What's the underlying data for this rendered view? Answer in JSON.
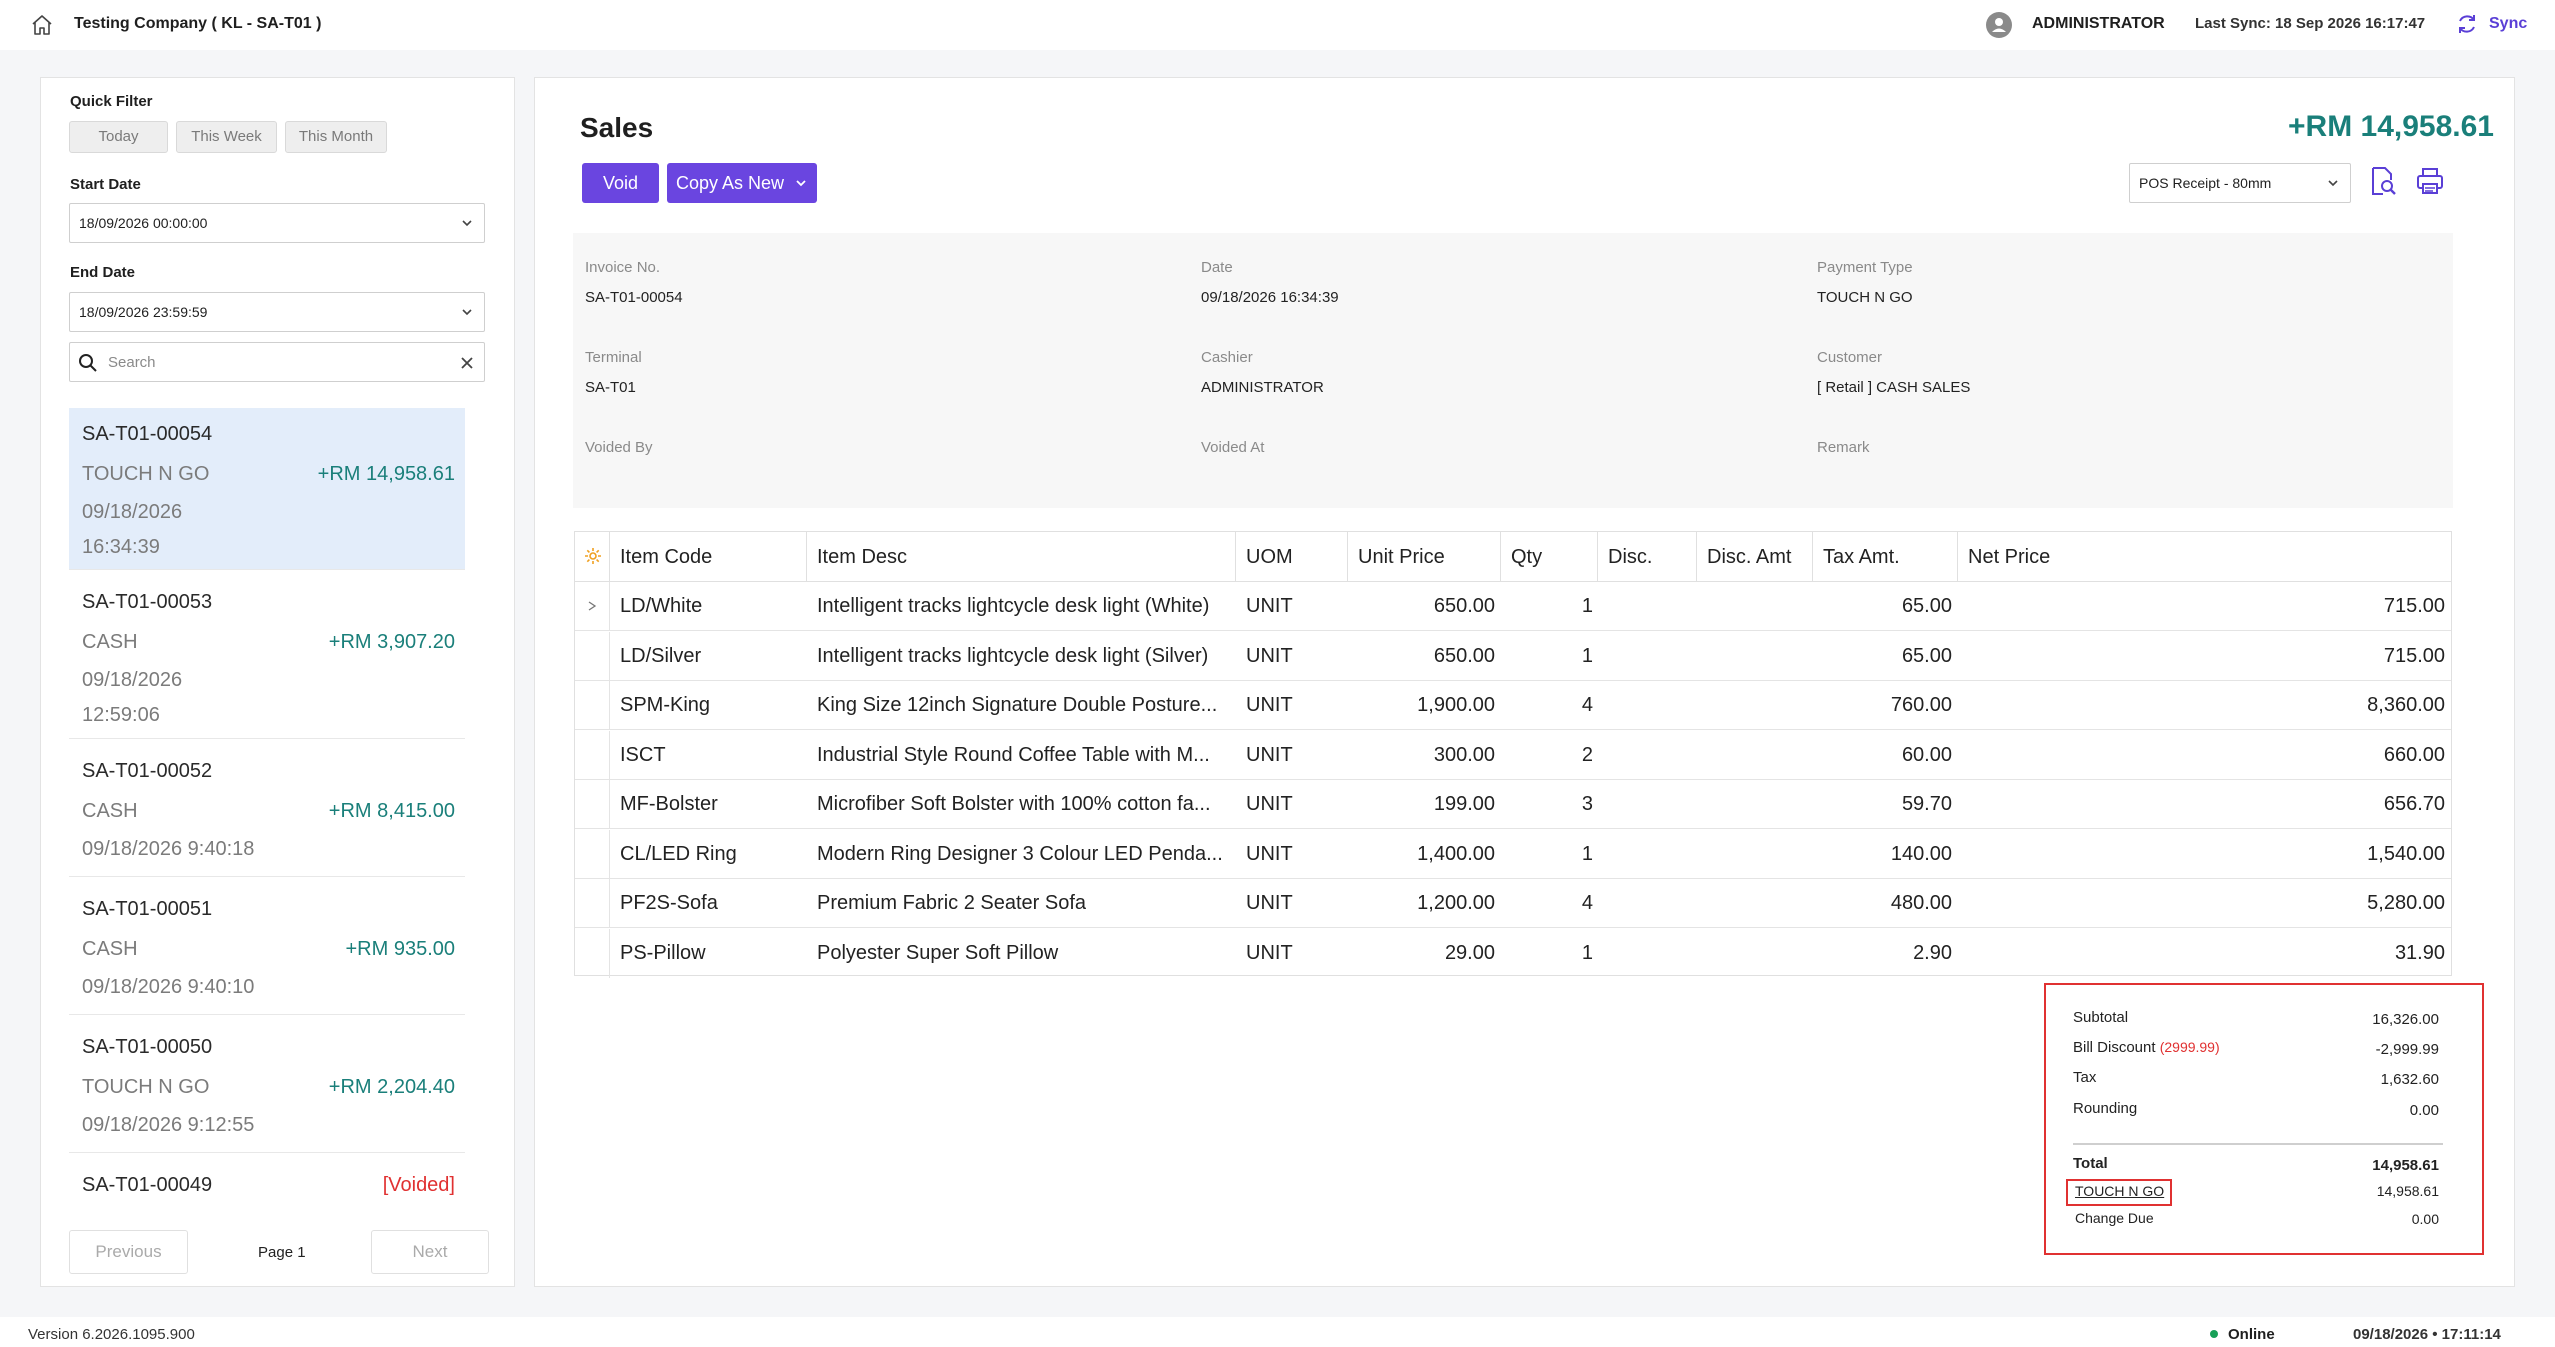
{
  "topbar": {
    "company": "Testing Company ( KL - SA-T01 )",
    "user": "ADMINISTRATOR",
    "last_sync": "Last Sync: 18 Sep 2026 16:17:47",
    "sync_label": "Sync"
  },
  "filter": {
    "quick_filter_label": "Quick Filter",
    "quick_filters": [
      "Today",
      "This Week",
      "This Month"
    ],
    "start_date_label": "Start Date",
    "start_date_value": "18/09/2026 00:00:00",
    "end_date_label": "End Date",
    "end_date_value": "18/09/2026 23:59:59",
    "search_placeholder": "Search"
  },
  "invoice_list": [
    {
      "no": "SA-T01-00054",
      "payment": "TOUCH N GO",
      "amount": "+RM 14,958.61",
      "date": "09/18/2026",
      "time": "16:34:39",
      "selected": true
    },
    {
      "no": "SA-T01-00053",
      "payment": "CASH",
      "amount": "+RM 3,907.20",
      "date": "09/18/2026",
      "time": "12:59:06"
    },
    {
      "no": "SA-T01-00052",
      "payment": "CASH",
      "amount": "+RM 8,415.00",
      "date": "09/18/2026 9:40:18"
    },
    {
      "no": "SA-T01-00051",
      "payment": "CASH",
      "amount": "+RM 935.00",
      "date": "09/18/2026 9:40:10"
    },
    {
      "no": "SA-T01-00050",
      "payment": "TOUCH N GO",
      "amount": "+RM 2,204.40",
      "date": "09/18/2026 9:12:55"
    },
    {
      "no": "SA-T01-00049",
      "status": "[Voided]"
    }
  ],
  "pager": {
    "previous": "Previous",
    "page": "Page 1",
    "next": "Next"
  },
  "main": {
    "title": "Sales",
    "total": "+RM 14,958.61",
    "void_label": "Void",
    "copy_label": "Copy As New",
    "receipt_format": "POS Receipt - 80mm"
  },
  "info": {
    "invoice_no_label": "Invoice No.",
    "invoice_no": "SA-T01-00054",
    "date_label": "Date",
    "date": "09/18/2026 16:34:39",
    "payment_type_label": "Payment Type",
    "payment_type": "TOUCH N GO",
    "terminal_label": "Terminal",
    "terminal": "SA-T01",
    "cashier_label": "Cashier",
    "cashier": "ADMINISTRATOR",
    "customer_label": "Customer",
    "customer": "[ Retail ] CASH SALES",
    "voided_by_label": "Voided By",
    "voided_at_label": "Voided At",
    "remark_label": "Remark"
  },
  "table": {
    "headers": [
      "Item Code",
      "Item Desc",
      "UOM",
      "Unit Price",
      "Qty",
      "Disc.",
      "Disc. Amt",
      "Tax Amt.",
      "Net Price"
    ],
    "rows": [
      {
        "code": "LD/White",
        "desc": "Intelligent tracks lightcycle desk light (White)",
        "uom": "UNIT",
        "price": "650.00",
        "qty": "1",
        "disc": "",
        "disc_amt": "",
        "tax": "65.00",
        "net": "715.00"
      },
      {
        "code": "LD/Silver",
        "desc": "Intelligent tracks lightcycle desk light (Silver)",
        "uom": "UNIT",
        "price": "650.00",
        "qty": "1",
        "disc": "",
        "disc_amt": "",
        "tax": "65.00",
        "net": "715.00"
      },
      {
        "code": "SPM-King",
        "desc": "King Size 12inch Signature Double Posture...",
        "uom": "UNIT",
        "price": "1,900.00",
        "qty": "4",
        "disc": "",
        "disc_amt": "",
        "tax": "760.00",
        "net": "8,360.00"
      },
      {
        "code": "ISCT",
        "desc": "Industrial Style Round Coffee Table with M...",
        "uom": "UNIT",
        "price": "300.00",
        "qty": "2",
        "disc": "",
        "disc_amt": "",
        "tax": "60.00",
        "net": "660.00"
      },
      {
        "code": "MF-Bolster",
        "desc": "Microfiber Soft Bolster with 100% cotton fa...",
        "uom": "UNIT",
        "price": "199.00",
        "qty": "3",
        "disc": "",
        "disc_amt": "",
        "tax": "59.70",
        "net": "656.70"
      },
      {
        "code": "CL/LED Ring",
        "desc": "Modern Ring Designer 3 Colour LED Penda...",
        "uom": "UNIT",
        "price": "1,400.00",
        "qty": "1",
        "disc": "",
        "disc_amt": "",
        "tax": "140.00",
        "net": "1,540.00"
      },
      {
        "code": "PF2S-Sofa",
        "desc": "Premium Fabric 2 Seater Sofa",
        "uom": "UNIT",
        "price": "1,200.00",
        "qty": "4",
        "disc": "",
        "disc_amt": "",
        "tax": "480.00",
        "net": "5,280.00"
      },
      {
        "code": "PS-Pillow",
        "desc": "Polyester Super Soft Pillow",
        "uom": "UNIT",
        "price": "29.00",
        "qty": "1",
        "disc": "",
        "disc_amt": "",
        "tax": "2.90",
        "net": "31.90"
      }
    ]
  },
  "summary": {
    "subtotal_label": "Subtotal",
    "subtotal": "16,326.00",
    "bill_discount_label": "Bill Discount",
    "bill_discount_note": "(2999.99)",
    "bill_discount": "-2,999.99",
    "tax_label": "Tax",
    "tax": "1,632.60",
    "rounding_label": "Rounding",
    "rounding": "0.00",
    "total_label": "Total",
    "total": "14,958.61",
    "payment_label": "TOUCH N GO",
    "payment": "14,958.61",
    "change_label": "Change Due",
    "change": "0.00"
  },
  "footer": {
    "version": "Version 6.2026.1095.900",
    "status": "Online",
    "clock": "09/18/2026 • 17:11:14"
  },
  "colors": {
    "accent": "#6a45e0",
    "positive": "#1a7f7a",
    "negative": "#e03131",
    "highlight_box": "#e03131"
  }
}
